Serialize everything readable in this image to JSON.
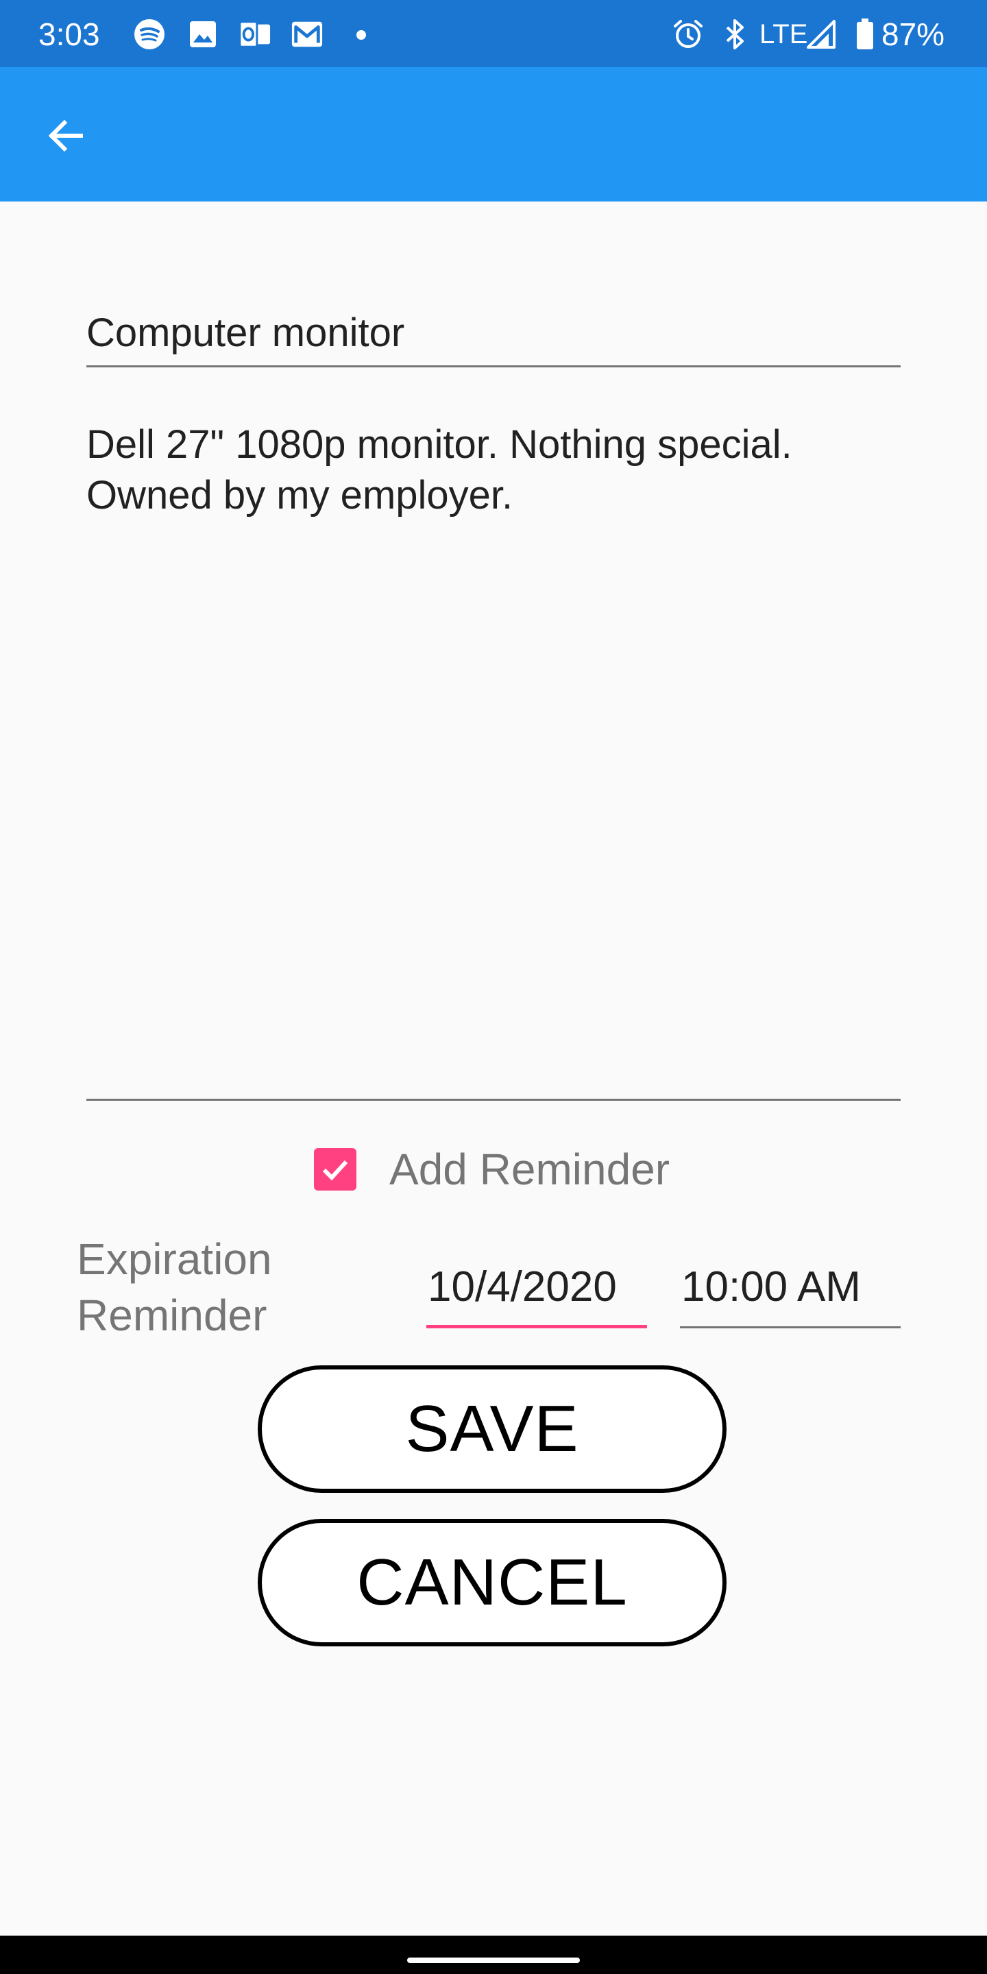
{
  "status_bar": {
    "time": "3:03",
    "network": "LTE",
    "battery": "87%",
    "icons": [
      "spotify-icon",
      "gallery-icon",
      "outlook-icon",
      "gmail-icon",
      "alarm-icon",
      "bluetooth-icon",
      "signal-icon",
      "battery-icon"
    ]
  },
  "app_bar": {
    "background_color": "#2196f3",
    "back_icon": "arrow-back-icon"
  },
  "form": {
    "title_value": "Computer monitor",
    "description_value": "Dell 27\" 1080p monitor. Nothing special.\nOwned by my employer.",
    "add_reminder_label": "Add Reminder",
    "add_reminder_checked": true,
    "expiration_label": "Expiration\nReminder",
    "date_value": "10/4/2020",
    "time_value": "10:00 AM",
    "accent_color": "#ff4081"
  },
  "buttons": {
    "save_label": "SAVE",
    "cancel_label": "CANCEL"
  }
}
